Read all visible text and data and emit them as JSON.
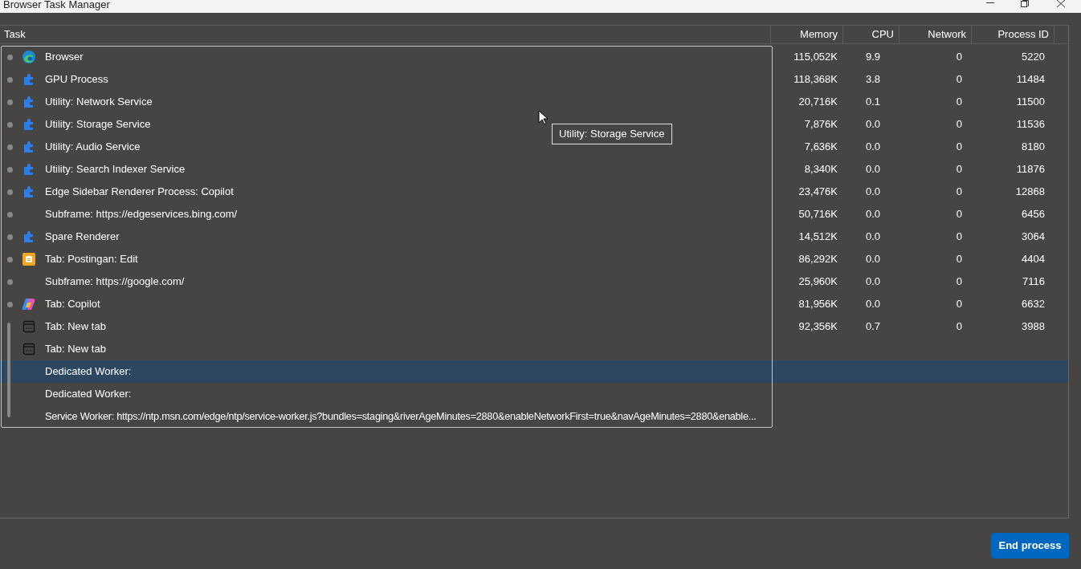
{
  "window": {
    "title": "Browser Task Manager"
  },
  "table": {
    "columns": [
      "Task",
      "Memory",
      "CPU",
      "Network",
      "Process ID"
    ],
    "rows": [
      {
        "kind": "edge",
        "bullet": true,
        "selected": false,
        "task": "Browser",
        "memory": "115,052K",
        "cpu": "9.9",
        "network": "0",
        "pid": "5220"
      },
      {
        "kind": "puzzle",
        "bullet": true,
        "selected": false,
        "task": "GPU Process",
        "memory": "118,368K",
        "cpu": "3.8",
        "network": "0",
        "pid": "11484"
      },
      {
        "kind": "puzzle",
        "bullet": true,
        "selected": false,
        "task": "Utility: Network Service",
        "memory": "20,716K",
        "cpu": "0.1",
        "network": "0",
        "pid": "11500"
      },
      {
        "kind": "puzzle",
        "bullet": true,
        "selected": false,
        "task": "Utility: Storage Service",
        "memory": "7,876K",
        "cpu": "0.0",
        "network": "0",
        "pid": "11536"
      },
      {
        "kind": "puzzle",
        "bullet": true,
        "selected": false,
        "task": "Utility: Audio Service",
        "memory": "7,636K",
        "cpu": "0.0",
        "network": "0",
        "pid": "8180"
      },
      {
        "kind": "puzzle",
        "bullet": true,
        "selected": false,
        "task": "Utility: Search Indexer Service",
        "memory": "8,340K",
        "cpu": "0.0",
        "network": "0",
        "pid": "11876"
      },
      {
        "kind": "puzzle",
        "bullet": true,
        "selected": false,
        "task": "Edge Sidebar Renderer Process: Copilot",
        "memory": "23,476K",
        "cpu": "0.0",
        "network": "0",
        "pid": "12868"
      },
      {
        "kind": "plain",
        "bullet": true,
        "selected": false,
        "task": "Subframe: https://edgeservices.bing.com/",
        "memory": "50,716K",
        "cpu": "0.0",
        "network": "0",
        "pid": "6456"
      },
      {
        "kind": "puzzle",
        "bullet": true,
        "selected": false,
        "task": "Spare Renderer",
        "memory": "14,512K",
        "cpu": "0.0",
        "network": "0",
        "pid": "3064"
      },
      {
        "kind": "blog",
        "bullet": true,
        "selected": false,
        "task": "Tab: Postingan: Edit",
        "memory": "86,292K",
        "cpu": "0.0",
        "network": "0",
        "pid": "4404"
      },
      {
        "kind": "plain",
        "bullet": true,
        "selected": false,
        "task": "Subframe: https://google.com/",
        "memory": "25,960K",
        "cpu": "0.0",
        "network": "0",
        "pid": "7116"
      },
      {
        "kind": "copilot",
        "bullet": true,
        "selected": false,
        "task": "Tab: Copilot",
        "memory": "81,956K",
        "cpu": "0.0",
        "network": "0",
        "pid": "6632"
      },
      {
        "kind": "newtab",
        "bullet": false,
        "selected": false,
        "task": "Tab: New tab",
        "memory": "92,356K",
        "cpu": "0.7",
        "network": "0",
        "pid": "3988"
      },
      {
        "kind": "newtab",
        "bullet": false,
        "selected": false,
        "task": "Tab: New tab"
      },
      {
        "kind": "plain",
        "bullet": false,
        "selected": true,
        "task": "Dedicated Worker:"
      },
      {
        "kind": "plain",
        "bullet": false,
        "selected": false,
        "task": "Dedicated Worker:"
      },
      {
        "kind": "plain",
        "bullet": false,
        "selected": false,
        "task": "Service Worker: https://ntp.msn.com/edge/ntp/service-worker.js?bundles=staging&riverAgeMinutes=2880&enableNetworkFirst=true&navAgeMinutes=2880&enable..."
      }
    ]
  },
  "tooltip": {
    "text": "Utility: Storage Service"
  },
  "buttons": [
    "End process"
  ]
}
